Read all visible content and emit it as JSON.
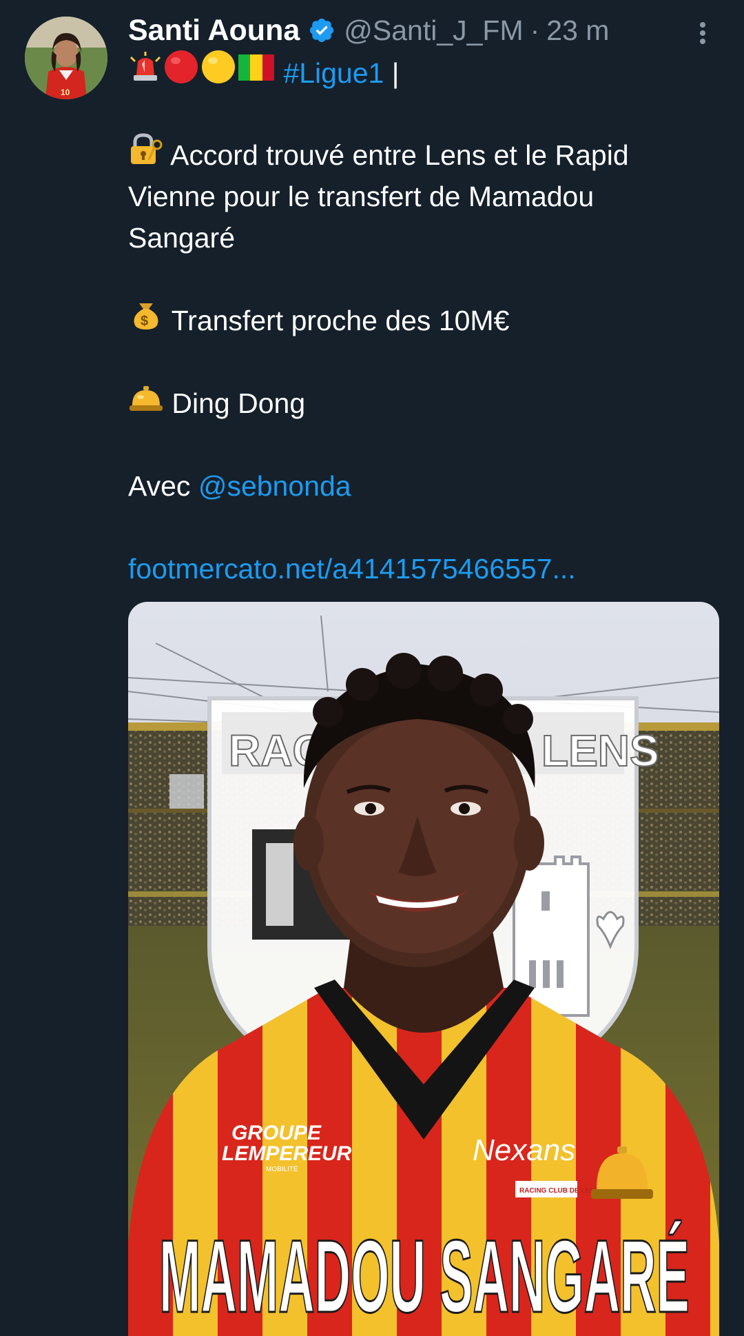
{
  "tweet": {
    "author": {
      "display_name": "Santi Aouna",
      "handle": "@Santi_J_FM",
      "separator": "·",
      "time": "23 m",
      "verified": true
    },
    "body": {
      "hashtag": "#Ligue1",
      "pipe": "|",
      "line1": "Accord trouvé entre Lens et le Rapid",
      "line2": "Vienne pour le transfert de Mamadou",
      "line3": "Sangaré",
      "transfer": "Transfert proche des 10M€",
      "ding": "Ding Dong",
      "with_label": "Avec",
      "mention": "@sebnonda",
      "link": "footmercato.net/a4141575466557..."
    },
    "media": {
      "banner_text": "MAMADOU SANGARÉ",
      "club_left": "RACI",
      "club_right": "LENS",
      "sponsor_left_1": "GROUPE",
      "sponsor_left_2": "LEMPEREUR",
      "sponsor_left_3": "MOBILITÉ",
      "sponsor_right": "Nexans",
      "badge_text": "RACING CLUB DE LENS"
    },
    "icons": {
      "verified": "verified-badge-icon",
      "more": "more-options-icon"
    },
    "colors": {
      "background": "#15202b",
      "link": "#1d9bf0",
      "muted": "#8b98a5",
      "verified": "#1d9bf0"
    }
  }
}
